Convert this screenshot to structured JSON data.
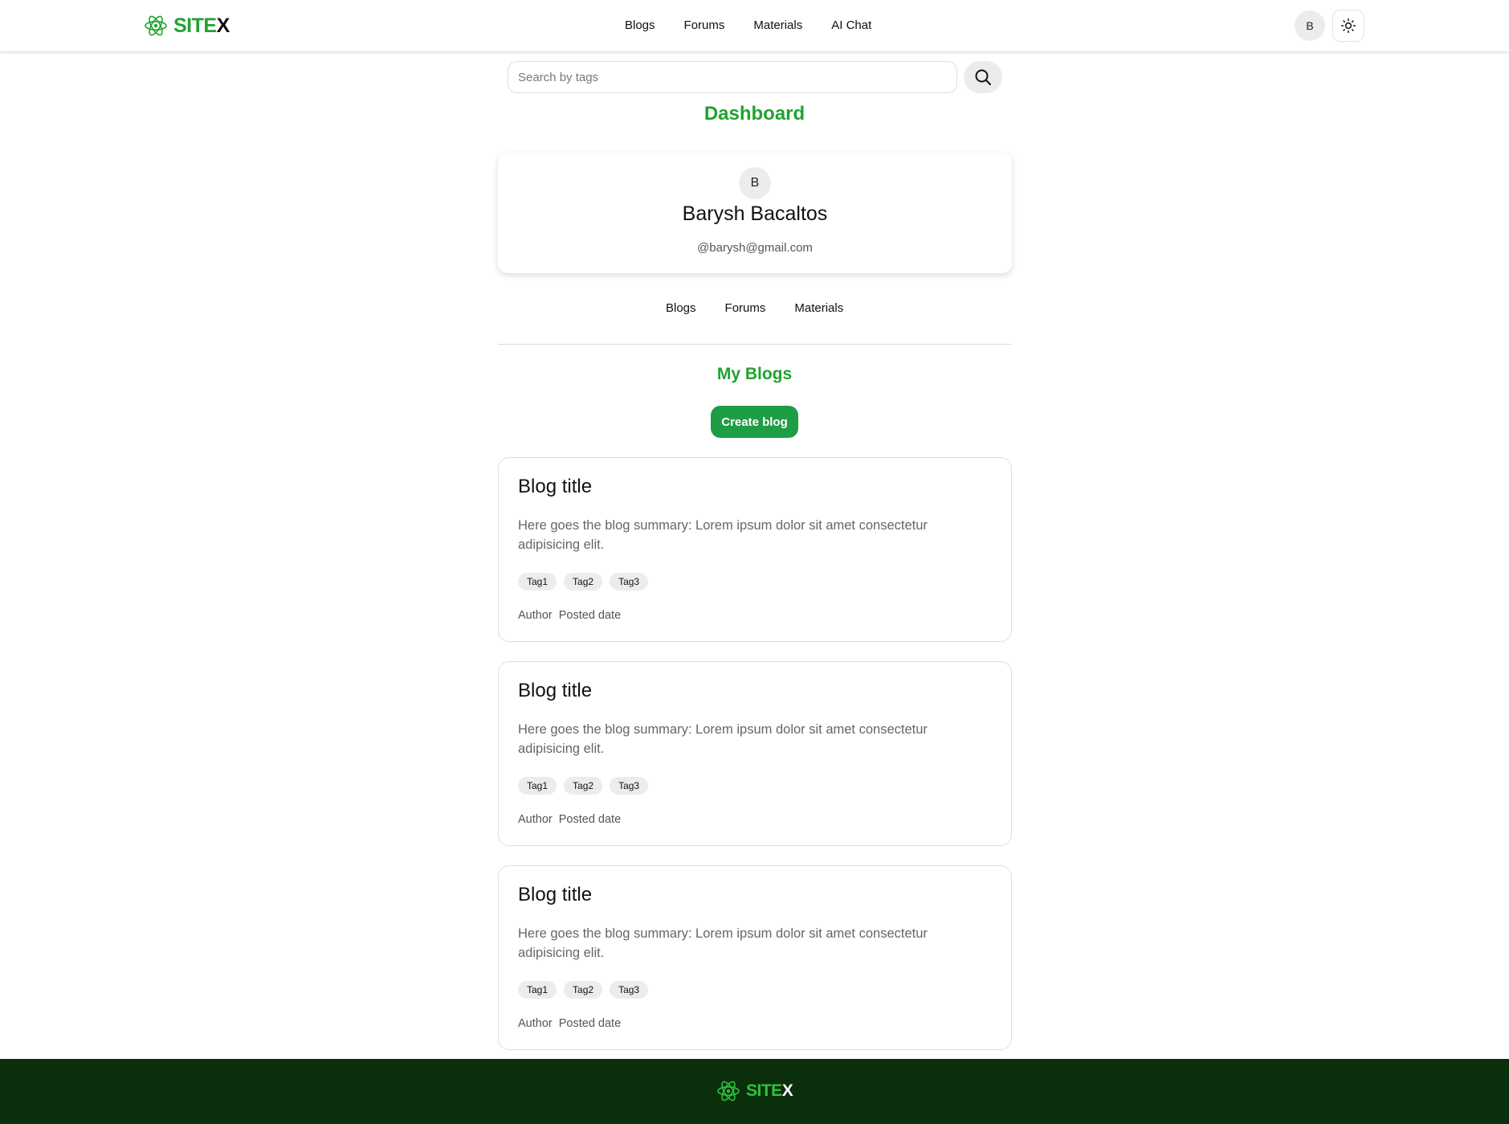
{
  "brand": {
    "site": "SITE",
    "x": "X",
    "logo_icon": "atom-icon"
  },
  "nav": {
    "links": [
      "Blogs",
      "Forums",
      "Materials",
      "AI Chat"
    ],
    "avatar_initial": "B",
    "theme_icon": "sun-icon"
  },
  "search": {
    "placeholder": "Search by tags",
    "value": "",
    "icon": "search-icon"
  },
  "dashboard": {
    "title": "Dashboard"
  },
  "profile": {
    "avatar_initial": "B",
    "name": "Barysh Bacaltos",
    "email": "@barysh@gmail.com"
  },
  "tabs": [
    "Blogs",
    "Forums",
    "Materials"
  ],
  "section": {
    "title": "My Blogs",
    "create_label": "Create blog"
  },
  "blogs": [
    {
      "title": "Blog title",
      "summary": "Here goes the blog summary: Lorem ipsum dolor sit amet consectetur adipisicing elit.",
      "tags": [
        "Tag1",
        "Tag2",
        "Tag3"
      ],
      "author": "Author",
      "date": "Posted date"
    },
    {
      "title": "Blog title",
      "summary": "Here goes the blog summary: Lorem ipsum dolor sit amet consectetur adipisicing elit.",
      "tags": [
        "Tag1",
        "Tag2",
        "Tag3"
      ],
      "author": "Author",
      "date": "Posted date"
    },
    {
      "title": "Blog title",
      "summary": "Here goes the blog summary: Lorem ipsum dolor sit amet consectetur adipisicing elit.",
      "tags": [
        "Tag1",
        "Tag2",
        "Tag3"
      ],
      "author": "Author",
      "date": "Posted date"
    }
  ],
  "footer": {
    "site": "SITE",
    "x": "X"
  },
  "colors": {
    "accent": "#1fa32f",
    "button": "#1d9d45",
    "footer_bg": "#0b2e0d"
  }
}
